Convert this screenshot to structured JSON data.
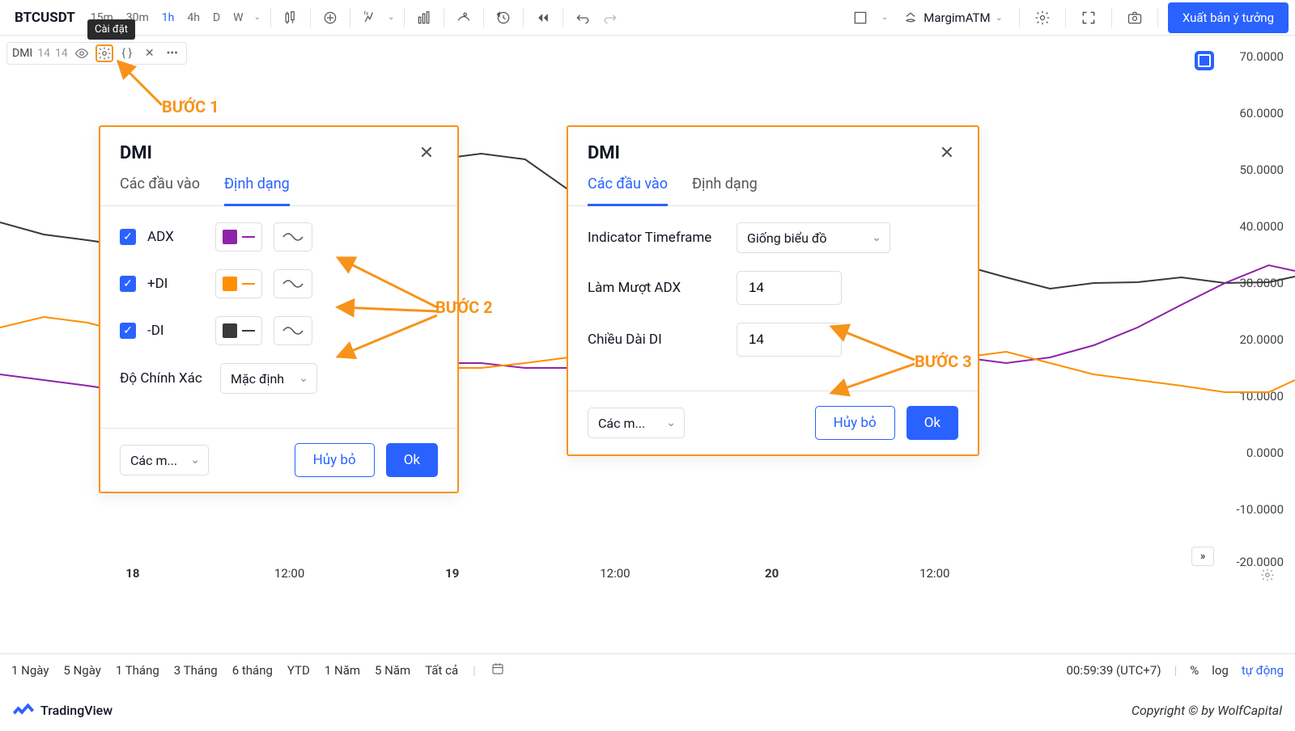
{
  "toolbar": {
    "symbol": "BTCUSDT",
    "tooltip": "Cài đặt",
    "timeframes": [
      "15m",
      "30m",
      "1h",
      "4h",
      "D",
      "W"
    ],
    "active_tf": "1h",
    "account": "MargimATM",
    "publish": "Xuất bản ý tưởng"
  },
  "indicator": {
    "name": "DMI",
    "p1": "14",
    "p2": "14"
  },
  "steps": {
    "s1": "BƯỚC 1",
    "s2": "BƯỚC 2",
    "s3": "BƯỚC 3"
  },
  "dialog1": {
    "title": "DMI",
    "tab_inputs": "Các đầu vào",
    "tab_style": "Định dạng",
    "adx": "ADX",
    "pdi": "+DI",
    "mdi": "-DI",
    "precision": "Độ Chính Xác",
    "precision_val": "Mặc định",
    "presets": "Các m...",
    "cancel": "Hủy bỏ",
    "ok": "Ok",
    "colors": {
      "adx": "#8e24aa",
      "pdi": "#ff8f00",
      "mdi": "#3a3a3a"
    }
  },
  "dialog2": {
    "title": "DMI",
    "tab_inputs": "Các đầu vào",
    "tab_style": "Định dạng",
    "tf_label": "Indicator Timeframe",
    "tf_value": "Giống biểu đồ",
    "adx_smooth": "Làm Mượt ADX",
    "adx_val": "14",
    "di_len": "Chiều Dài DI",
    "di_val": "14",
    "presets": "Các m...",
    "cancel": "Hủy bỏ",
    "ok": "Ok"
  },
  "yaxis": [
    "70.0000",
    "60.0000",
    "50.0000",
    "40.0000",
    "30.0000",
    "20.0000",
    "10.0000",
    "0.0000",
    "-10.0000",
    "-20.0000"
  ],
  "xaxis": [
    {
      "label": "18",
      "pos": 11,
      "bold": true
    },
    {
      "label": "12:00",
      "pos": 24,
      "bold": false
    },
    {
      "label": "19",
      "pos": 37.5,
      "bold": true
    },
    {
      "label": "12:00",
      "pos": 51,
      "bold": false
    },
    {
      "label": "20",
      "pos": 64,
      "bold": true
    },
    {
      "label": "12:00",
      "pos": 77.5,
      "bold": false
    }
  ],
  "ranges": [
    "1 Ngày",
    "5 Ngày",
    "1 Tháng",
    "3 Tháng",
    "6 tháng",
    "YTD",
    "1 Năm",
    "5 Năm",
    "Tất cả"
  ],
  "clock": "00:59:39 (UTC+7)",
  "scale": {
    "pct": "%",
    "log": "log",
    "auto": "tự động"
  },
  "footer": {
    "brand": "TradingView",
    "copy": "Copyright © by WolfCapital"
  },
  "chart_data": {
    "type": "line",
    "ylim": [
      -20,
      70
    ],
    "series": [
      {
        "name": "-DI",
        "color": "#3a3a3a",
        "values": [
          38,
          36,
          35,
          34,
          34,
          35,
          36,
          38,
          42,
          45,
          49,
          50,
          49,
          44,
          38,
          34,
          30,
          28,
          27,
          31,
          34,
          33,
          31,
          29,
          27,
          28,
          28,
          29,
          28,
          28,
          29,
          30,
          30
        ]
      },
      {
        "name": "ADX",
        "color": "#8e24aa",
        "values": [
          12,
          11,
          10,
          9,
          9,
          10,
          11,
          11,
          12,
          13,
          14,
          14,
          13,
          13,
          12,
          11,
          10,
          9,
          9,
          10,
          12,
          14,
          15,
          14,
          15,
          17,
          20,
          24,
          28,
          31,
          32,
          31,
          30
        ]
      },
      {
        "name": "+DI",
        "color": "#ff8f00",
        "values": [
          20,
          22,
          21,
          19,
          18,
          19,
          18,
          17,
          16,
          14,
          13,
          13,
          14,
          15,
          15,
          16,
          16,
          15,
          14,
          14,
          14,
          15,
          15,
          16,
          14,
          12,
          11,
          10,
          9,
          9,
          10,
          11,
          11
        ]
      }
    ]
  }
}
